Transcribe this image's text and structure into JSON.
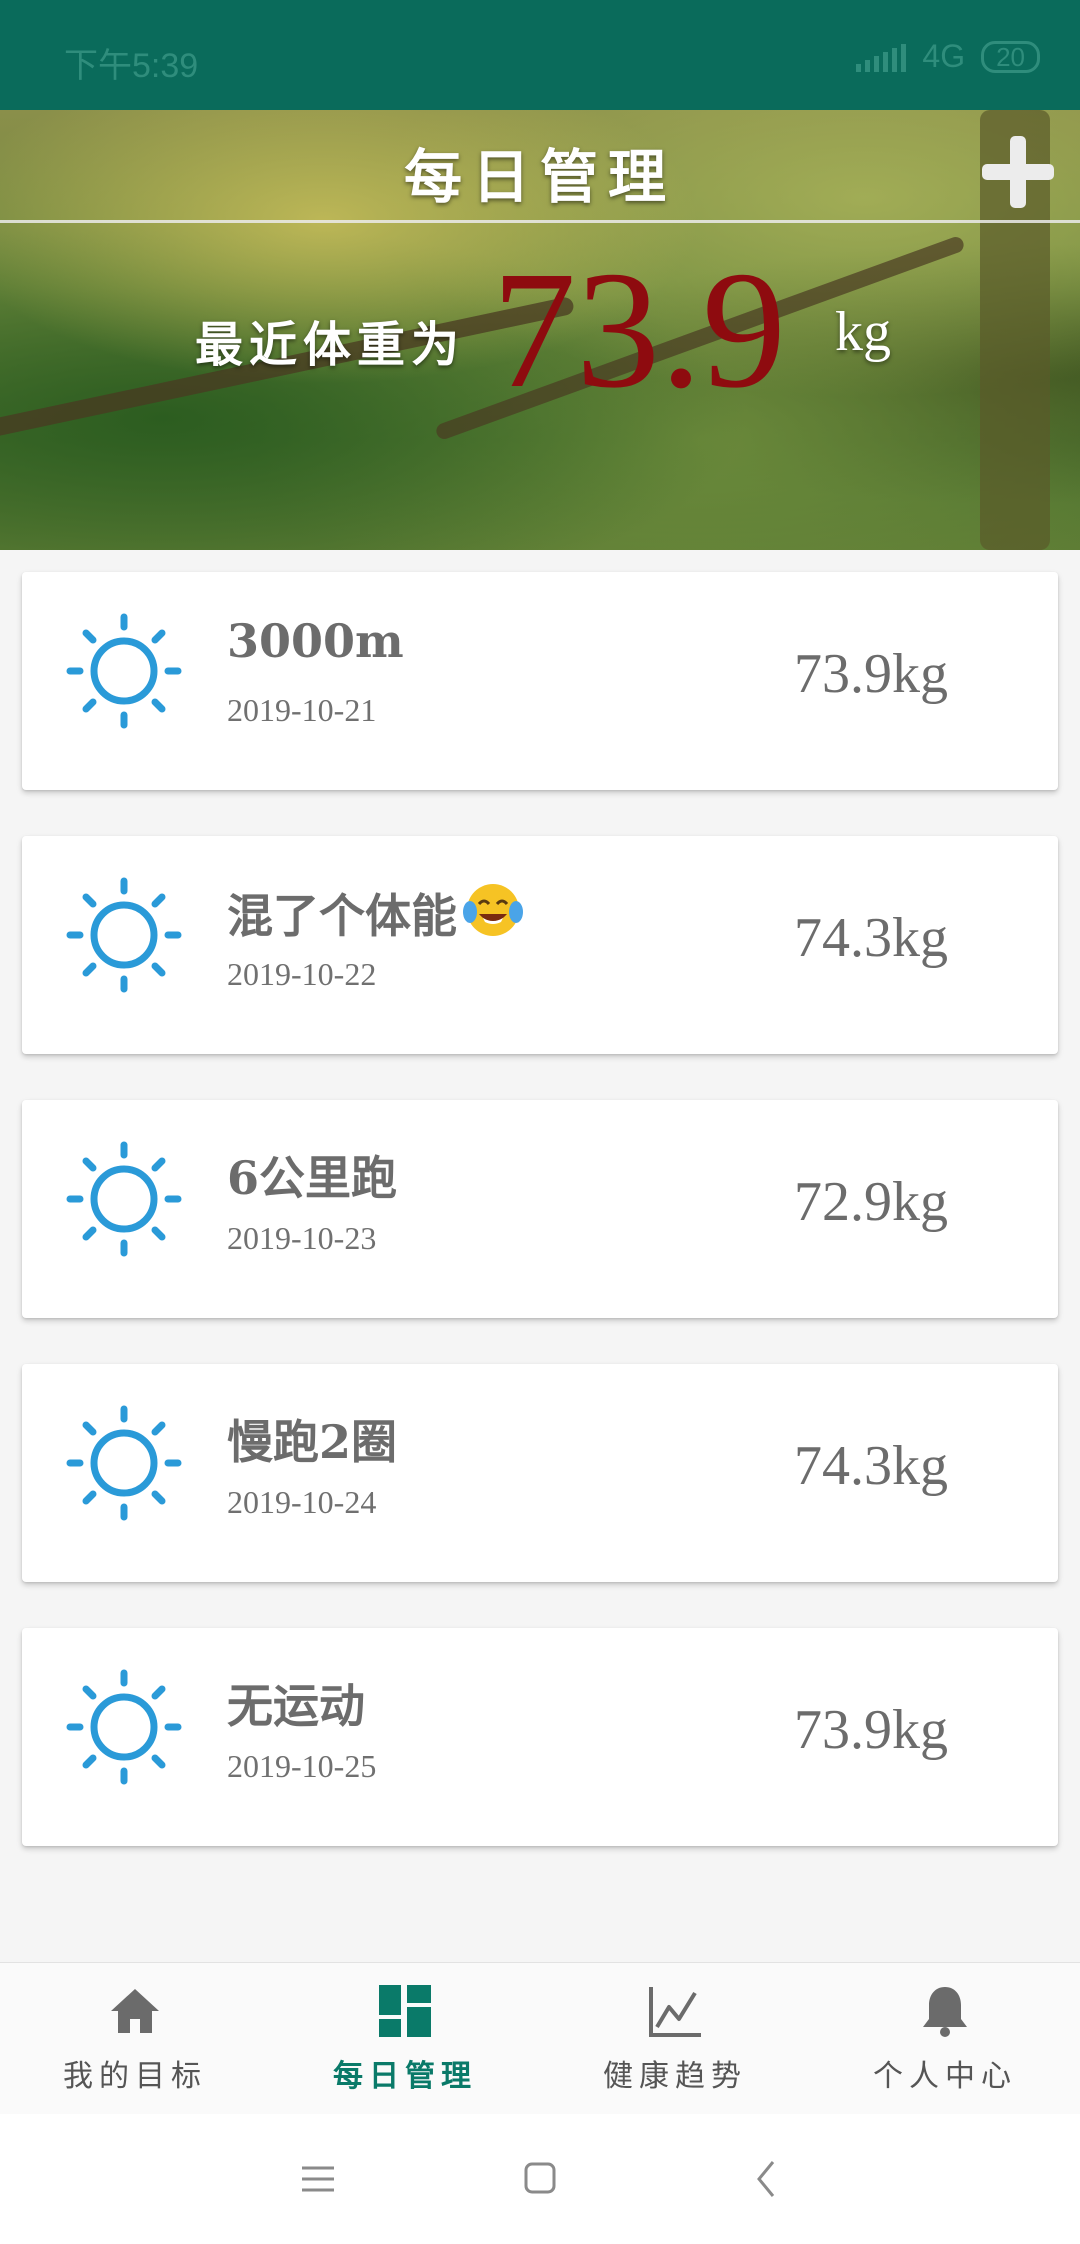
{
  "status_bar": {
    "time": "下午5:39",
    "network": "4G",
    "battery": "20"
  },
  "header": {
    "title": "每日管理",
    "weight_label": "最近体重为",
    "weight_value": "73.9",
    "weight_unit": "kg",
    "add_icon": "plus-icon"
  },
  "records": [
    {
      "title": "3000m",
      "date": "2019-10-21",
      "weight": "73.9kg",
      "icon": "sun-icon",
      "emoji": ""
    },
    {
      "title": "混了个体能",
      "date": "2019-10-22",
      "weight": "74.3kg",
      "icon": "sun-icon",
      "emoji": "tears-of-joy-emoji"
    },
    {
      "title": "6公里跑",
      "date": "2019-10-23",
      "weight": "72.9kg",
      "icon": "sun-icon",
      "emoji": ""
    },
    {
      "title": "慢跑2圈",
      "date": "2019-10-24",
      "weight": "74.3kg",
      "icon": "sun-icon",
      "emoji": ""
    },
    {
      "title": "无运动",
      "date": "2019-10-25",
      "weight": "73.9kg",
      "icon": "sun-icon",
      "emoji": ""
    }
  ],
  "bottom_nav": [
    {
      "label": "我的目标",
      "icon": "home-icon",
      "active": false
    },
    {
      "label": "每日管理",
      "icon": "dashboard-icon",
      "active": true
    },
    {
      "label": "健康趋势",
      "icon": "trend-chart-icon",
      "active": false
    },
    {
      "label": "个人中心",
      "icon": "bell-icon",
      "active": false
    }
  ],
  "colors": {
    "primary": "#0a6b5b",
    "accent_active": "#0a7a69",
    "weight_highlight": "#8e0b0f",
    "sun_icon": "#2a9ad8"
  }
}
